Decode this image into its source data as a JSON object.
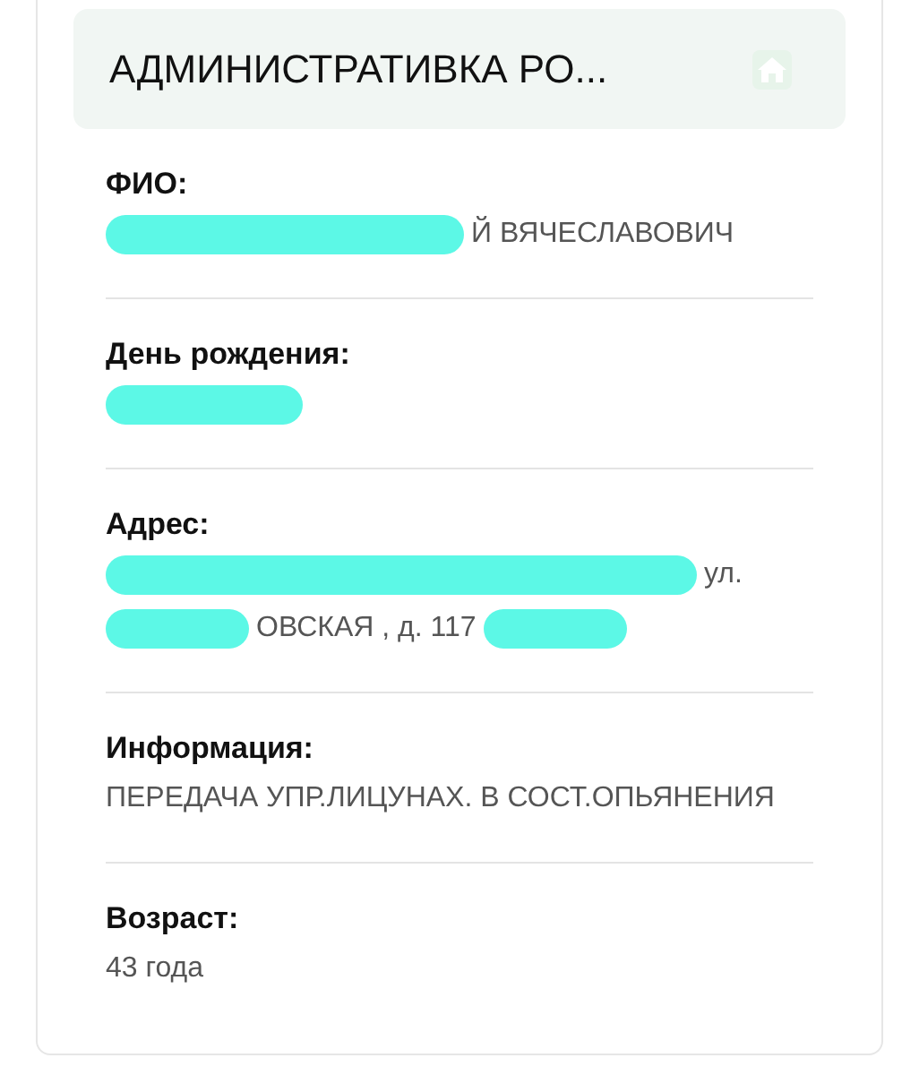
{
  "header": {
    "title": "АДМИНИСТРАТИВКА РО..."
  },
  "fields": [
    {
      "label": "ФИО:",
      "lines": [
        [
          {
            "kind": "redacted-medium"
          },
          {
            "kind": "text",
            "text": "Й ВЯЧЕСЛАВОВИЧ"
          }
        ]
      ]
    },
    {
      "label": "День рождения:",
      "lines": [
        [
          {
            "kind": "redacted-short"
          }
        ]
      ]
    },
    {
      "label": "Адрес:",
      "lines": [
        [
          {
            "kind": "redacted-long"
          },
          {
            "kind": "text",
            "text": "ул."
          }
        ],
        [
          {
            "kind": "redacted-tiny"
          },
          {
            "kind": "text",
            "text": "ОВСКАЯ , д. 117"
          },
          {
            "kind": "redacted-tiny"
          }
        ]
      ]
    },
    {
      "label": "Информация:",
      "lines": [
        [
          {
            "kind": "text",
            "text": "ПЕРЕДАЧА УПР.ЛИЦУНАХ. В СОСТ.ОПЬЯНЕНИЯ"
          }
        ]
      ]
    },
    {
      "label": "Возраст:",
      "lines": [
        [
          {
            "kind": "text",
            "text": "43 года"
          }
        ]
      ]
    }
  ]
}
